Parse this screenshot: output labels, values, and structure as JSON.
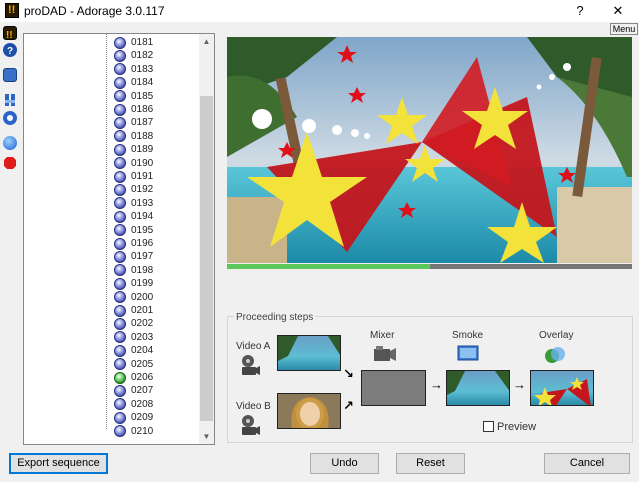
{
  "window": {
    "title": "proDAD - Adorage 3.0.117",
    "help_label": "?",
    "close_label": "✕",
    "menu_label": "Menu"
  },
  "toolbar": {
    "icons": [
      "warning-icon",
      "help-icon",
      "screen-icon",
      "filter-icon",
      "settings-icon",
      "blue-ball-icon",
      "red-stop-icon"
    ]
  },
  "tree": {
    "items": [
      "0181",
      "0182",
      "0183",
      "0184",
      "0185",
      "0186",
      "0187",
      "0188",
      "0189",
      "0190",
      "0191",
      "0192",
      "0193",
      "0194",
      "0195",
      "0196",
      "0197",
      "0198",
      "0199",
      "0200",
      "0201",
      "0202",
      "0203",
      "0204",
      "0205",
      "0206",
      "0207",
      "0208",
      "0209",
      "0210"
    ],
    "selected": "0206"
  },
  "playback": {
    "progress": 0.5
  },
  "steps": {
    "legend": "Proceeding steps",
    "video_a": "Video A",
    "video_b": "Video B",
    "mixer": "Mixer",
    "smoke": "Smoke",
    "overlay": "Overlay",
    "preview_label": "Preview",
    "preview_checked": false
  },
  "buttons": {
    "export": "Export sequence",
    "undo": "Undo",
    "reset": "Reset",
    "cancel": "Cancel"
  }
}
